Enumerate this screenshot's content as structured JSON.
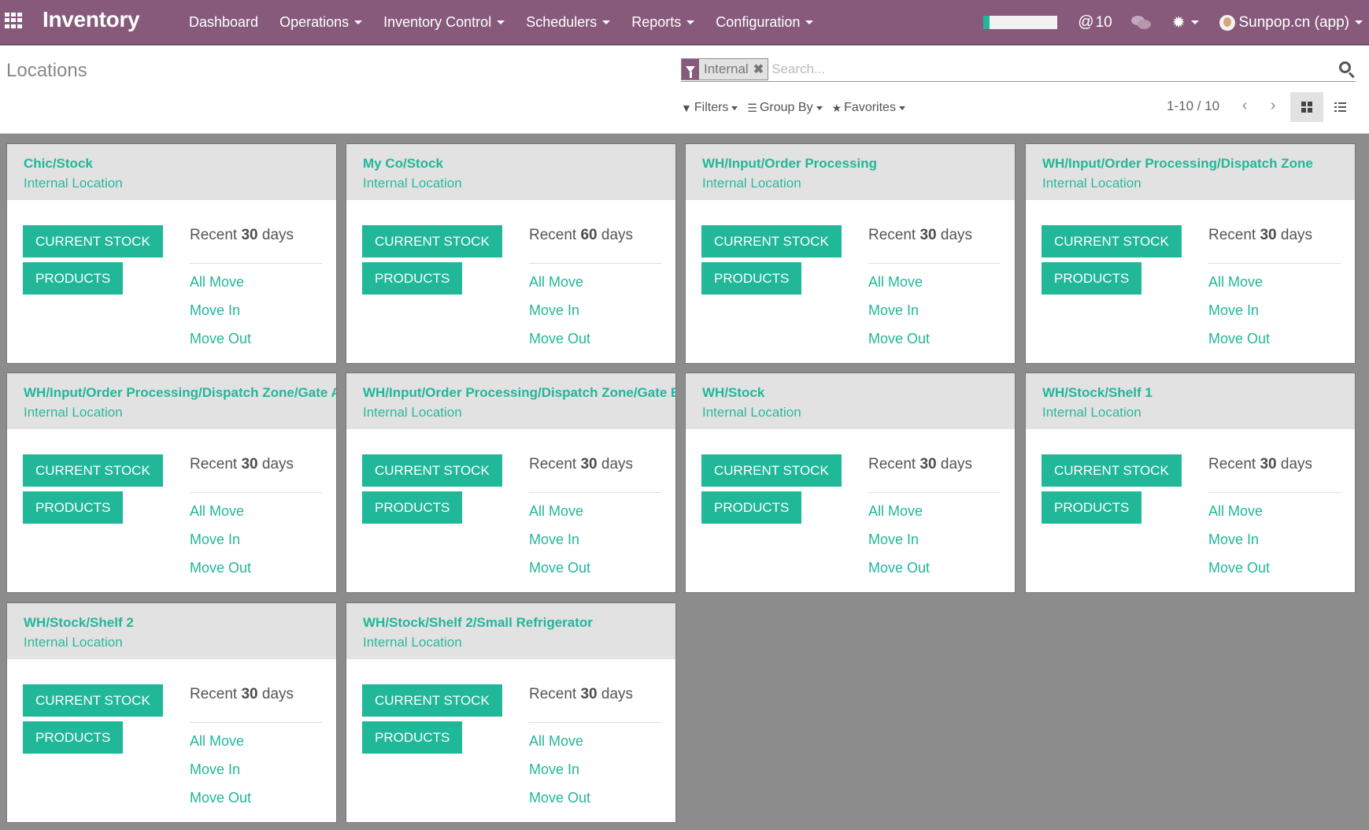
{
  "navbar": {
    "brand": "Inventory",
    "menu": [
      {
        "label": "Dashboard",
        "has_dropdown": false
      },
      {
        "label": "Operations",
        "has_dropdown": true
      },
      {
        "label": "Inventory Control",
        "has_dropdown": true
      },
      {
        "label": "Schedulers",
        "has_dropdown": true
      },
      {
        "label": "Reports",
        "has_dropdown": true
      },
      {
        "label": "Configuration",
        "has_dropdown": true
      }
    ],
    "progress_fraction": 0.08,
    "mention_symbol": "@",
    "mention_count": "10",
    "bug_glyph": "🐞",
    "user_name": "Sunpop.cn (app)",
    "colors": {
      "navbar": "#875a7b",
      "accent": "#21b799"
    }
  },
  "control_panel": {
    "title": "Locations",
    "search": {
      "facet_label": "Internal",
      "facet_close": "✖",
      "placeholder": "Search..."
    },
    "options": {
      "filters": "Filters",
      "group_by": "Group By",
      "favorites": "Favorites"
    },
    "pager": {
      "value": "1-10 / 10",
      "prev": "‹",
      "next": "›"
    },
    "views": [
      "kanban",
      "list"
    ],
    "active_view": "kanban"
  },
  "cards": [
    {
      "name": "Chic/Stock",
      "type": "Internal Location",
      "recent_prefix": "Recent",
      "days": "30",
      "recent_suffix": "days"
    },
    {
      "name": "My Co/Stock",
      "type": "Internal Location",
      "recent_prefix": "Recent",
      "days": "60",
      "recent_suffix": "days"
    },
    {
      "name": "WH/Input/Order Processing",
      "type": "Internal Location",
      "recent_prefix": "Recent",
      "days": "30",
      "recent_suffix": "days"
    },
    {
      "name": "WH/Input/Order Processing/Dispatch Zone",
      "type": "Internal Location",
      "recent_prefix": "Recent",
      "days": "30",
      "recent_suffix": "days"
    },
    {
      "name": "WH/Input/Order Processing/Dispatch Zone/Gate A",
      "type": "Internal Location",
      "recent_prefix": "Recent",
      "days": "30",
      "recent_suffix": "days"
    },
    {
      "name": "WH/Input/Order Processing/Dispatch Zone/Gate B",
      "type": "Internal Location",
      "recent_prefix": "Recent",
      "days": "30",
      "recent_suffix": "days"
    },
    {
      "name": "WH/Stock",
      "type": "Internal Location",
      "recent_prefix": "Recent",
      "days": "30",
      "recent_suffix": "days"
    },
    {
      "name": "WH/Stock/Shelf 1",
      "type": "Internal Location",
      "recent_prefix": "Recent",
      "days": "30",
      "recent_suffix": "days"
    },
    {
      "name": "WH/Stock/Shelf 2",
      "type": "Internal Location",
      "recent_prefix": "Recent",
      "days": "30",
      "recent_suffix": "days"
    },
    {
      "name": "WH/Stock/Shelf 2/Small Refrigerator",
      "type": "Internal Location",
      "recent_prefix": "Recent",
      "days": "30",
      "recent_suffix": "days"
    }
  ],
  "card_labels": {
    "current_stock": "CURRENT STOCK",
    "products": "PRODUCTS",
    "all_move": "All Move",
    "move_in": "Move In",
    "move_out": "Move Out"
  }
}
